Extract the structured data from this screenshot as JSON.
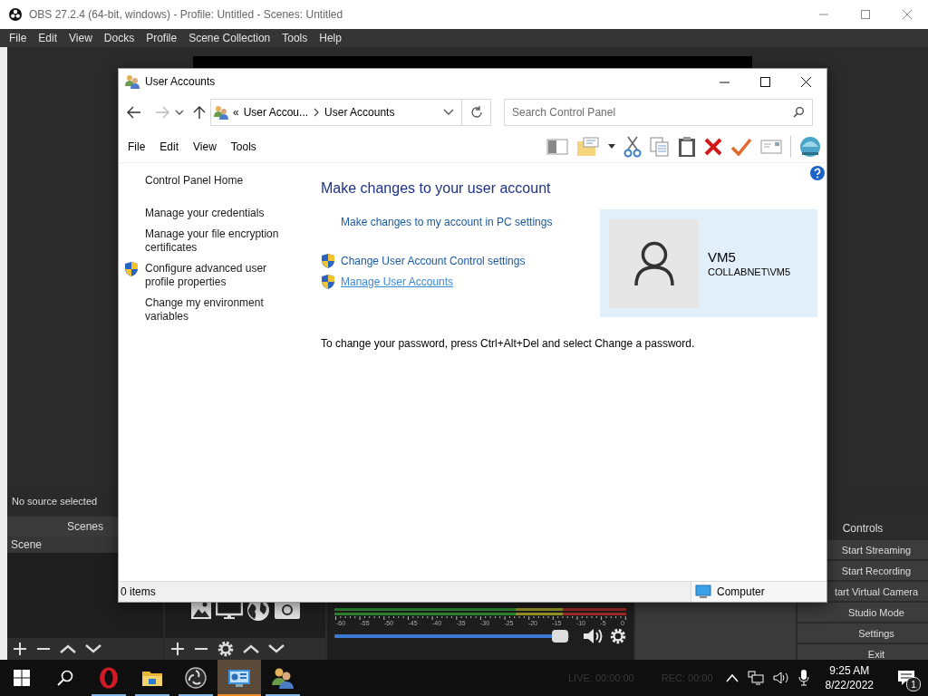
{
  "obs": {
    "title": "OBS 27.2.4 (64-bit, windows) - Profile: Untitled - Scenes: Untitled",
    "menu": [
      "File",
      "Edit",
      "View",
      "Docks",
      "Profile",
      "Scene Collection",
      "Tools",
      "Help"
    ],
    "source_status": "No source selected",
    "scenes": {
      "title": "Scenes",
      "items": [
        {
          "label": "Scene",
          "selected": true
        }
      ]
    },
    "mixer": {
      "scale": [
        "-60",
        "-55",
        "-50",
        "-45",
        "-40",
        "-35",
        "-30",
        "-25",
        "-20",
        "-15",
        "-10",
        "-5",
        "0"
      ],
      "volume": {
        "level": 0.96
      }
    },
    "controls": {
      "title": "Controls",
      "buttons": [
        "Start Streaming",
        "Start Recording",
        "tart Virtual Camera",
        "Studio Mode",
        "Settings",
        "Exit"
      ]
    },
    "status_bar": [
      "LIVE: 00:00:00",
      "REC: 00:00"
    ]
  },
  "window": {
    "title": "User Accounts",
    "address": {
      "overflow": "«",
      "crumbs": [
        "User Accou...",
        "User Accounts"
      ]
    },
    "search": {
      "placeholder": "Search Control Panel"
    },
    "menu": [
      "File",
      "Edit",
      "View",
      "Tools"
    ],
    "sidebar": {
      "items": [
        {
          "label": "Control Panel Home",
          "kind": "home",
          "shield": false
        },
        {
          "label": "Manage your credentials",
          "kind": "task",
          "shield": false
        },
        {
          "label": "Manage your file encryption certificates",
          "kind": "task",
          "shield": false
        },
        {
          "label": "Configure advanced user profile properties",
          "kind": "task",
          "shield": true
        },
        {
          "label": "Change my environment variables",
          "kind": "task",
          "shield": false
        }
      ]
    },
    "main": {
      "heading": "Make changes to your user account",
      "links": [
        {
          "label": "Make changes to my account in PC settings",
          "shield": false,
          "hovered": false
        },
        {
          "label": "Change User Account Control settings",
          "shield": true,
          "hovered": false
        },
        {
          "label": "Manage User Accounts",
          "shield": true,
          "hovered": true
        }
      ],
      "note": "To change your password, press Ctrl+Alt+Del and select Change a password.",
      "user": {
        "name": "VM5",
        "account": "COLLABNET\\VM5"
      }
    },
    "status_bar": {
      "count": "0 items",
      "location": "Computer"
    }
  },
  "taskbar": {
    "apps": [
      {
        "kind": "start",
        "open": false,
        "selected": false
      },
      {
        "kind": "search",
        "open": false,
        "selected": false
      },
      {
        "kind": "ring",
        "open": true,
        "selected": false
      },
      {
        "kind": "folder",
        "open": true,
        "selected": false
      },
      {
        "kind": "aperture",
        "open": true,
        "selected": false
      },
      {
        "kind": "control-panel",
        "open": true,
        "selected": true
      },
      {
        "kind": "users",
        "open": true,
        "selected": false
      }
    ],
    "tray": {
      "time": "9:25 AM",
      "date": "8/22/2022",
      "notifications": "1"
    }
  }
}
